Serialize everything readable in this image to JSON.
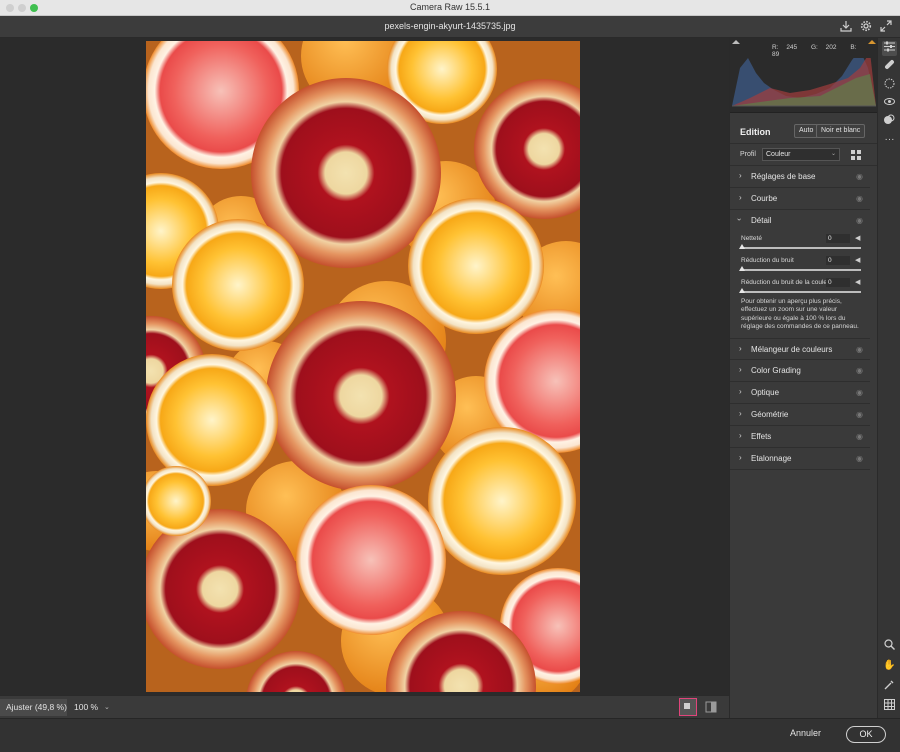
{
  "window": {
    "title": "Camera Raw 15.5.1"
  },
  "file": {
    "name": "pexels-engin-akyurt-1435735.jpg"
  },
  "topbar_icons": [
    "save-icon",
    "gear-icon",
    "expand-icon"
  ],
  "histogram": {
    "r_label": "R:",
    "r_value": "245",
    "g_label": "G:",
    "g_value": "202",
    "b_label": "B:",
    "b_value": "89"
  },
  "edit": {
    "title": "Edition",
    "auto_label": "Auto",
    "bw_label": "Noir et blanc",
    "profile_label": "Profil",
    "profile_value": "Couleur"
  },
  "sections_top": [
    {
      "label": "Réglages de base",
      "expanded": false
    },
    {
      "label": "Courbe",
      "expanded": false
    },
    {
      "label": "Détail",
      "expanded": true
    }
  ],
  "detail": {
    "sharpening_label": "Netteté",
    "sharpening_value": "0",
    "noise_label": "Réduction du bruit",
    "noise_value": "0",
    "color_noise_label": "Réduction du bruit de la couleur",
    "color_noise_value": "0",
    "note": "Pour obtenir un aperçu plus précis, effectuez un zoom sur une valeur supérieure ou égale à 100 % lors du réglage des commandes de ce panneau."
  },
  "sections_bottom": [
    {
      "label": "Mélangeur de couleurs"
    },
    {
      "label": "Color Grading"
    },
    {
      "label": "Optique"
    },
    {
      "label": "Géométrie"
    },
    {
      "label": "Effets"
    },
    {
      "label": "Etalonnage"
    }
  ],
  "bottom": {
    "fit_label": "Ajuster (49,8 %)",
    "zoom_label": "100 %"
  },
  "footer": {
    "cancel_label": "Annuler",
    "ok_label": "OK"
  },
  "tools": [
    "edit-sliders-icon",
    "healing-brush-icon",
    "masking-icon",
    "red-eye-icon",
    "presets-icon",
    "more-icon",
    "zoom-icon",
    "hand-icon",
    "color-sampler-icon",
    "grid-overlay-icon"
  ],
  "colors": {
    "accent_pink": "#e0457b",
    "panel_bg": "#3a3a3a",
    "canvas_bg": "#2b2b2b"
  }
}
